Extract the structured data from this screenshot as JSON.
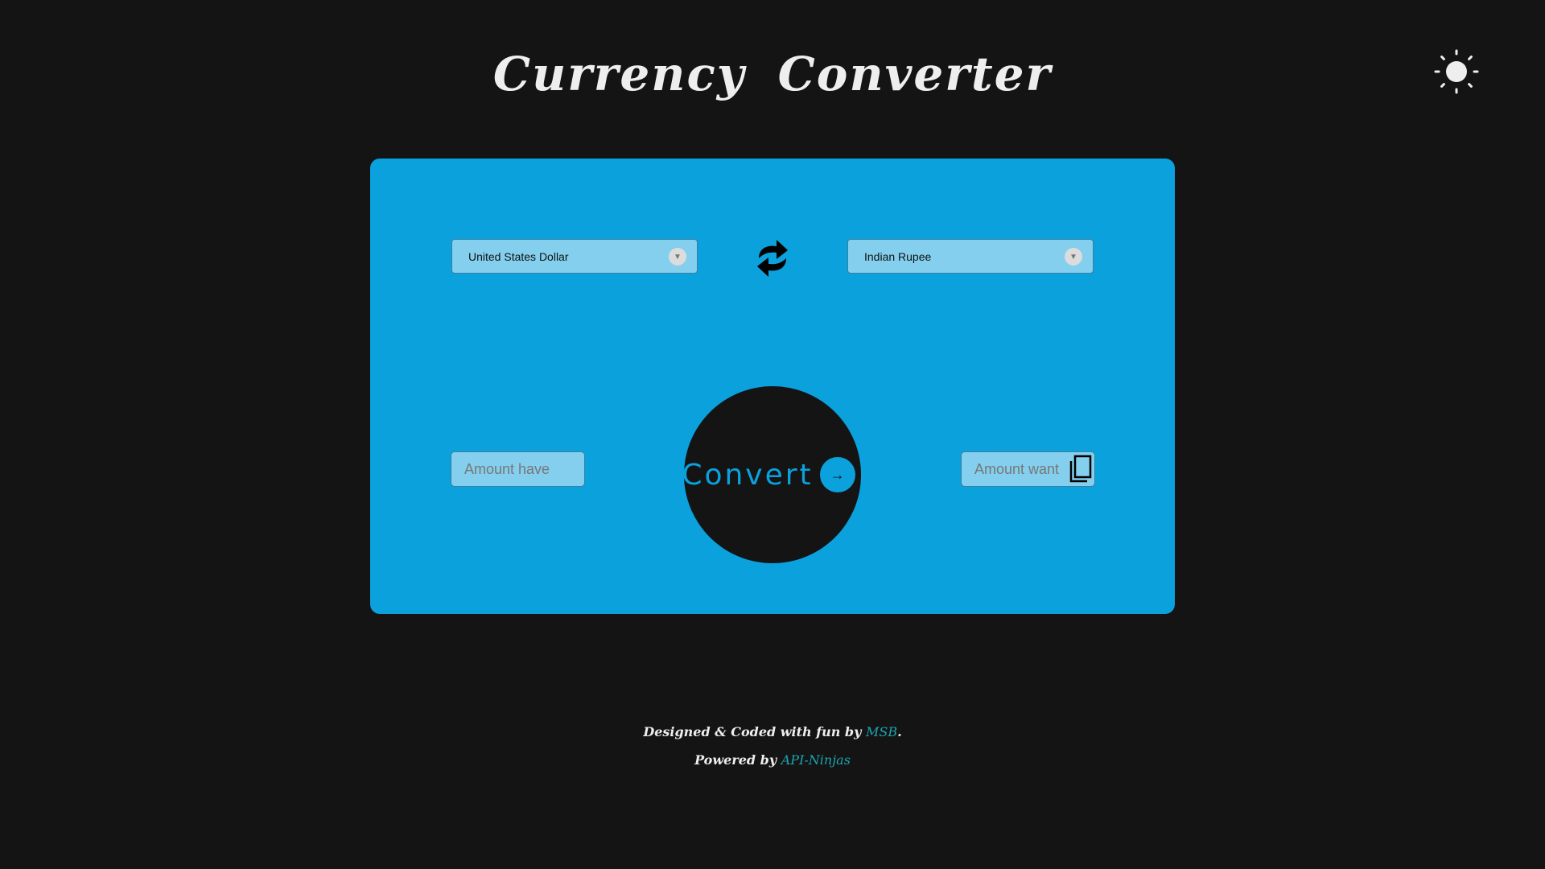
{
  "header": {
    "title": "Currency Converter",
    "theme_icon": "sun-icon"
  },
  "converter": {
    "from_currency": "United States Dollar",
    "to_currency": "Indian Rupee",
    "swap_icon": "swap-arrows-icon",
    "amount_have_placeholder": "Amount have",
    "amount_want_placeholder": "Amount want",
    "convert_label": "Convert",
    "copy_icon": "copy-icon"
  },
  "footer": {
    "line1_prefix": "Designed & Coded with fun by ",
    "line1_link": "MSB",
    "line1_suffix": ".",
    "line2_prefix": "Powered by ",
    "line2_link": "API-Ninjas"
  },
  "colors": {
    "background": "#141414",
    "card": "#0aa1dd",
    "field": "#84cfee",
    "link": "#1aa6b0"
  }
}
